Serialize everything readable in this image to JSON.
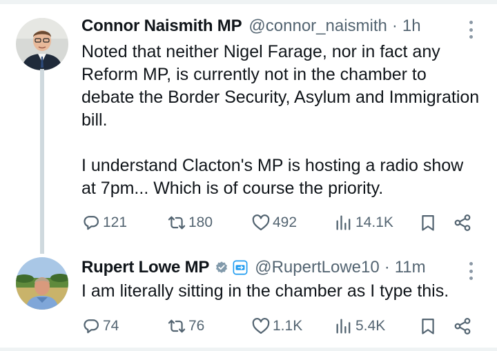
{
  "tweets": [
    {
      "author_name": "Connor Naismith MP",
      "handle": "@connor_naismith",
      "separator": "·",
      "time": "1h",
      "text": "Noted that neither Nigel Farage, nor in fact any Reform MP, is currently not in the chamber to debate the Border Security, Asylum and Immigration bill.\n\nI understand Clacton's MP is hosting a radio show at 7pm... Which is of course the priority.",
      "replies": "121",
      "reposts": "180",
      "likes": "492",
      "views": "14.1K"
    },
    {
      "author_name": "Rupert Lowe MP",
      "handle": "@RupertLowe10",
      "separator": "·",
      "time": "11m",
      "verified_badge": "gray-verified-check",
      "affiliate_badge": "affiliate-square-badge",
      "text": "I am literally sitting in the chamber as I type this.",
      "replies": "74",
      "reposts": "76",
      "likes": "1.1K",
      "views": "5.4K"
    }
  ],
  "icons": {
    "reply": "reply-icon",
    "repost": "repost-icon",
    "like": "like-icon",
    "views": "views-icon",
    "bookmark": "bookmark-icon",
    "share": "share-icon",
    "more": "more-icon"
  },
  "colors": {
    "text": "#0f1419",
    "secondary": "#536471",
    "thread_line": "#cfd9de",
    "verified_gray": "#829aab",
    "affiliate_blue": "#1d9bf0"
  }
}
